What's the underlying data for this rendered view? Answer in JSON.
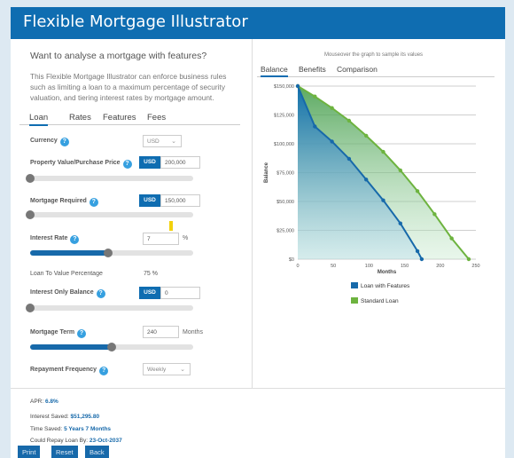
{
  "header": {
    "title": "Flexible Mortgage Illustrator"
  },
  "intro": {
    "question": "Want to analyse a mortgage with features?",
    "description": "This Flexible Mortgage Illustrator can enforce business rules such as limiting a loan to a maximum percentage of security valuation, and tiering interest rates by mortgage amount."
  },
  "tabs": [
    {
      "label": "Loan",
      "active": true
    },
    {
      "label": "Rates"
    },
    {
      "label": "Features"
    },
    {
      "label": "Fees"
    }
  ],
  "loan": {
    "currency_label": "Currency",
    "currency_value": "USD",
    "property_label": "Property Value/Purchase Price",
    "property_currency": "USD",
    "property_value": "200,000",
    "property_slider": 0.0,
    "mortgage_label": "Mortgage Required",
    "mortgage_currency": "USD",
    "mortgage_value": "150,000",
    "mortgage_slider": 0.0,
    "rate_label": "Interest Rate",
    "rate_value": "7",
    "rate_unit": "%",
    "rate_slider": 0.48,
    "ltv_label": "Loan To Value Percentage",
    "ltv_value": "75 %",
    "io_label": "Interest Only Balance",
    "io_currency": "USD",
    "io_value": "0",
    "io_slider": 0.0,
    "term_label": "Mortgage Term",
    "term_value": "240",
    "term_unit": "Months",
    "term_slider": 0.5,
    "freq_label": "Repayment Frequency",
    "freq_value": "Weekly"
  },
  "summary": {
    "apr_label": "APR:",
    "apr_value": "6.8%",
    "saved_label": "Interest Saved:",
    "saved_value": "$51,295.80",
    "time_label": "Time Saved:",
    "time_value": "5 Years 7 Months",
    "repay_label": "Could Repay Loan By:",
    "repay_value": "23-Oct-2037"
  },
  "buttons": {
    "print": "Print",
    "reset": "Reset",
    "back": "Back"
  },
  "chart_tabs": [
    {
      "label": "Balance",
      "active": true
    },
    {
      "label": "Benefits"
    },
    {
      "label": "Comparison"
    }
  ],
  "chart_note": "Mouseover the graph to sample its values",
  "colors": {
    "brand": "#0f6db1",
    "features": "#1769aa",
    "standard": "#6db33f"
  },
  "chart_data": {
    "type": "area",
    "xlabel": "Months",
    "ylabel": "Balance",
    "xlim": [
      0,
      250
    ],
    "ylim": [
      0,
      150000
    ],
    "x_ticks": [
      "0",
      "50",
      "100",
      "150",
      "200",
      "250"
    ],
    "y_ticks": [
      "$0",
      "$25,000",
      "$50,000",
      "$75,000",
      "$100,000",
      "$125,000",
      "$150,000"
    ],
    "legend_position": "bottom",
    "series": [
      {
        "name": "Loan with Features",
        "color": "#1769aa",
        "points": [
          [
            0,
            150000
          ],
          [
            24,
            115000
          ],
          [
            48,
            102000
          ],
          [
            72,
            87000
          ],
          [
            96,
            69000
          ],
          [
            120,
            51000
          ],
          [
            144,
            31000
          ],
          [
            168,
            7000
          ],
          [
            174,
            0
          ]
        ]
      },
      {
        "name": "Standard Loan",
        "color": "#6db33f",
        "points": [
          [
            0,
            150000
          ],
          [
            24,
            141000
          ],
          [
            48,
            131000
          ],
          [
            72,
            120000
          ],
          [
            96,
            107000
          ],
          [
            120,
            93000
          ],
          [
            144,
            77000
          ],
          [
            168,
            59000
          ],
          [
            192,
            39000
          ],
          [
            216,
            18000
          ],
          [
            240,
            0
          ]
        ]
      }
    ]
  }
}
